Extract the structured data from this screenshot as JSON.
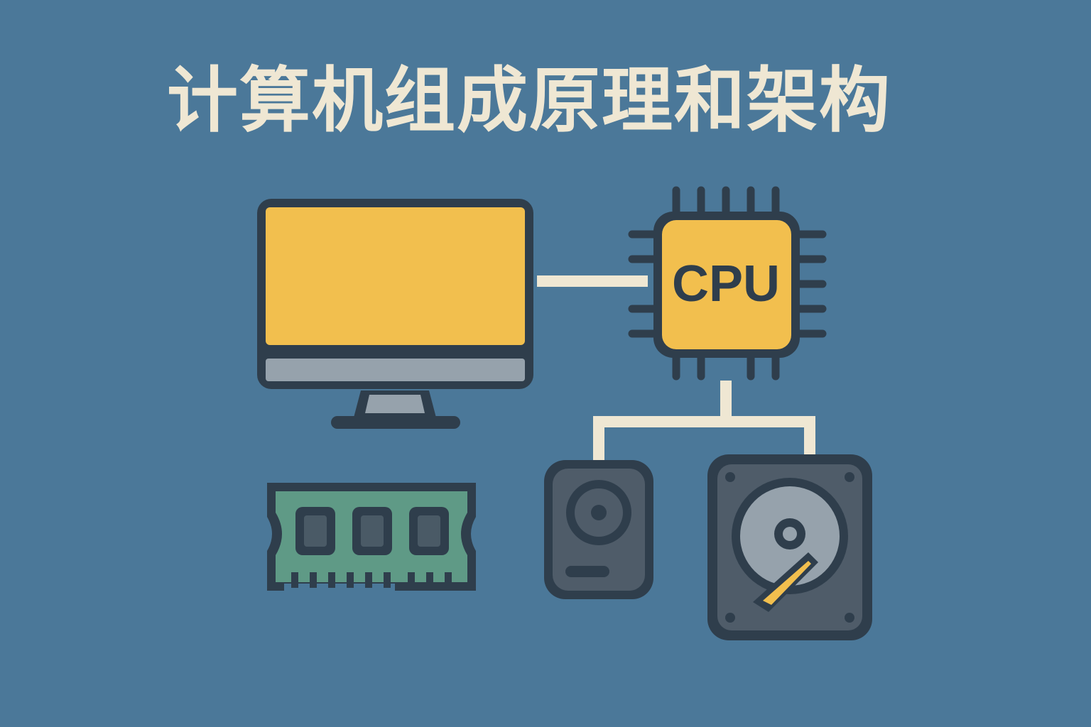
{
  "title": "计算机组成原理和架构",
  "cpu": {
    "label": "CPU"
  },
  "colors": {
    "background": "#4b7899",
    "title": "#efe7d3",
    "outline": "#2f3e4c",
    "screen": "#f2bf4e",
    "screen_bezel": "#96a2ac",
    "cpu": "#f2bf4e",
    "bus": "#efe7d3",
    "ram_board": "#5f9a86",
    "ram_chip": "#4a5a66",
    "drive_body": "#4f5c69",
    "platter": "#96a2ac",
    "needle": "#f2bf4e"
  },
  "components": [
    {
      "name": "monitor",
      "icon": "monitor-icon"
    },
    {
      "name": "cpu",
      "icon": "cpu-chip-icon"
    },
    {
      "name": "ram",
      "icon": "ram-module-icon"
    },
    {
      "name": "optical-drive",
      "icon": "optical-drive-icon"
    },
    {
      "name": "hard-disk",
      "icon": "hard-disk-icon"
    }
  ]
}
